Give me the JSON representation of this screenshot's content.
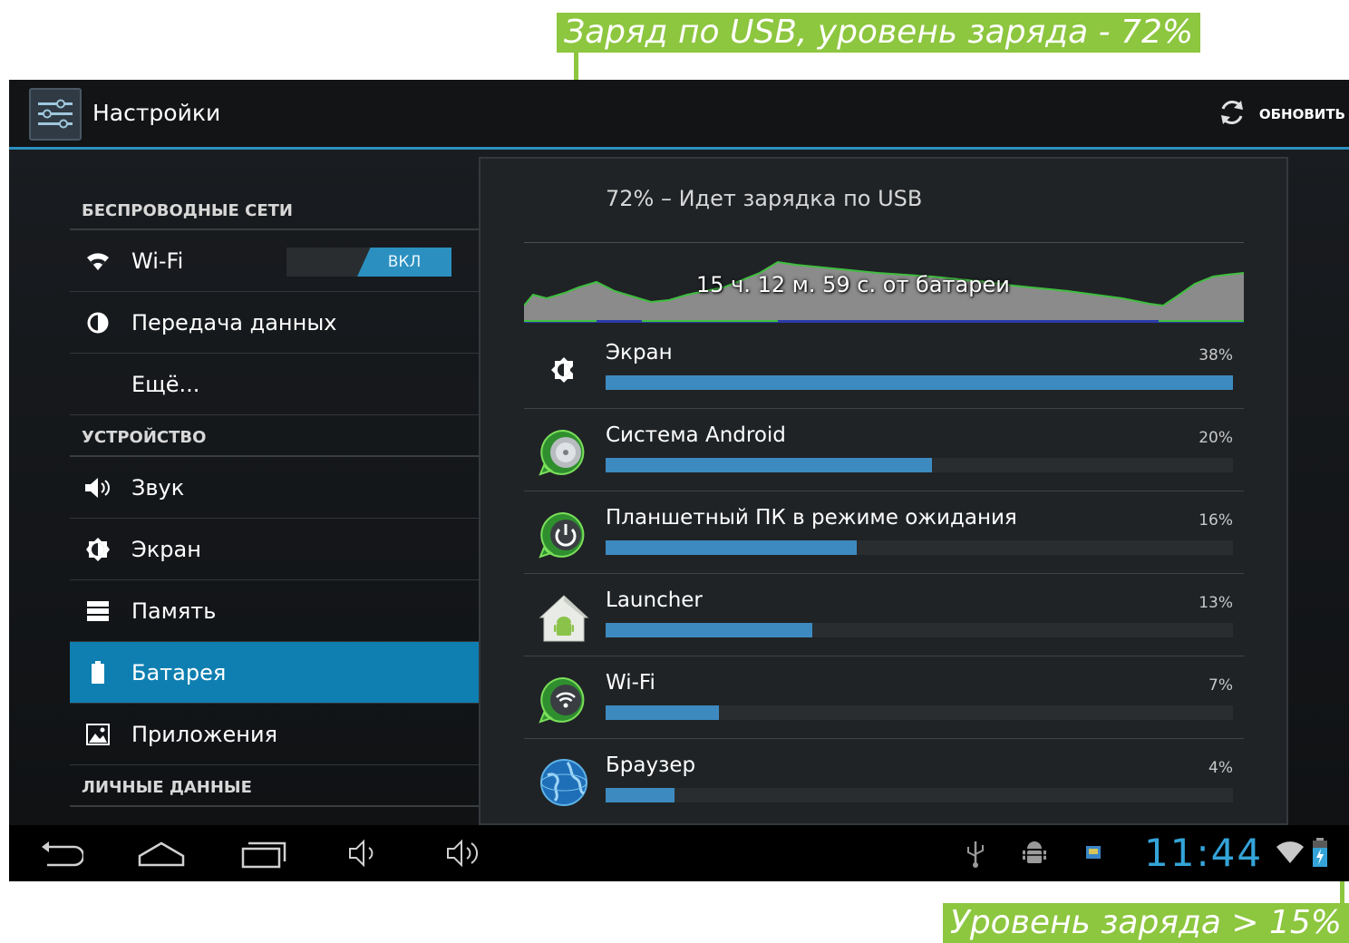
{
  "callouts": {
    "top": "Заряд по USB, уровень заряда - 72%",
    "bottom": "Уровень заряда > 15%"
  },
  "actionbar": {
    "title": "Настройки",
    "app_icon": "settings-icon",
    "refresh_label": "ОБНОВИТЬ",
    "refresh_icon": "refresh-icon"
  },
  "settings": {
    "sections": [
      {
        "header": "БЕСПРОВОДНЫЕ СЕТИ"
      },
      {
        "header": "УСТРОЙСТВО"
      },
      {
        "header": "ЛИЧНЫЕ ДАННЫЕ"
      }
    ],
    "items": [
      {
        "label": "Wi-Fi",
        "icon": "wifi-icon",
        "toggle": "ВКЛ"
      },
      {
        "label": "Передача данных",
        "icon": "data-usage-icon"
      },
      {
        "label": "Ещё..."
      },
      {
        "label": "Звук",
        "icon": "volume-icon"
      },
      {
        "label": "Экран",
        "icon": "brightness-icon"
      },
      {
        "label": "Память",
        "icon": "storage-icon"
      },
      {
        "label": "Батарея",
        "icon": "battery-icon",
        "selected": true
      },
      {
        "label": "Приложения",
        "icon": "apps-icon"
      }
    ]
  },
  "battery": {
    "status": "72% – Идет зарядка по USB",
    "graph_label": "15 ч. 12 м. 59 с. от батареи",
    "usage": [
      {
        "label": "Экран",
        "percent_label": "38%",
        "fraction": 1.0,
        "icon": "brightness-icon"
      },
      {
        "label": "Система Android",
        "percent_label": "20%",
        "fraction": 0.52,
        "icon": "android-system-icon"
      },
      {
        "label": "Планшетный ПК в режиме ожидания",
        "percent_label": "16%",
        "fraction": 0.4,
        "icon": "power-icon"
      },
      {
        "label": "Launcher",
        "percent_label": "13%",
        "fraction": 0.33,
        "icon": "launcher-icon"
      },
      {
        "label": "Wi-Fi",
        "percent_label": "7%",
        "fraction": 0.18,
        "icon": "wifi-icon"
      },
      {
        "label": "Браузер",
        "percent_label": "4%",
        "fraction": 0.11,
        "icon": "browser-globe-icon"
      }
    ]
  },
  "navbar": {
    "clock": "11:44",
    "buttons": [
      "back-icon",
      "home-icon",
      "recent-apps-icon",
      "volume-down-icon",
      "volume-up-icon"
    ],
    "status_icons": [
      "usb-icon",
      "debug-android-icon",
      "notification-icon",
      "wifi-signal-icon",
      "battery-charging-icon"
    ]
  },
  "colors": {
    "accent": "#2b90c0",
    "callout": "#8dc63f",
    "bar": "#3d8ac0",
    "clock": "#34a4d8"
  }
}
